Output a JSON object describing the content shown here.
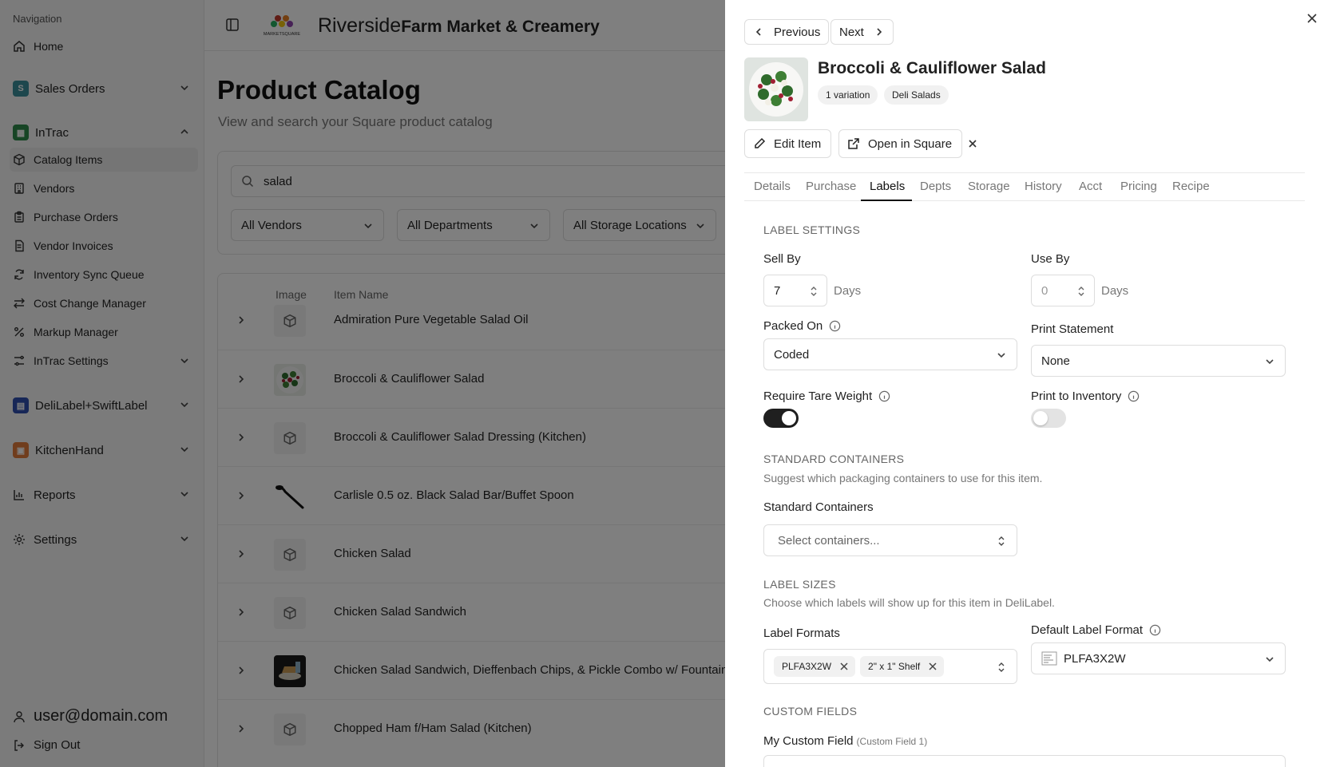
{
  "sidebar": {
    "heading": "Navigation",
    "home": "Home",
    "sales_orders": "Sales Orders",
    "intrac": "InTrac",
    "items": [
      "Catalog Items",
      "Vendors",
      "Purchase Orders",
      "Vendor Invoices",
      "Inventory Sync Queue",
      "Cost Change Manager",
      "Markup Manager",
      "InTrac Settings"
    ],
    "delilabel": "DeliLabel+SwiftLabel",
    "kitchenhand": "KitchenHand",
    "reports": "Reports",
    "settings": "Settings",
    "user": "user@domain.com",
    "sign_out": "Sign Out"
  },
  "header": {
    "brand_light": "Riverside",
    "brand_bold": "Farm Market & Creamery",
    "logo_text": "MARKETSQUARE"
  },
  "page": {
    "title": "Product Catalog",
    "subtitle": "View and search your Square product catalog"
  },
  "filters": {
    "search_value": "salad",
    "vendors": "All Vendors",
    "departments": "All Departments",
    "storage": "All Storage Locations"
  },
  "table": {
    "col_image": "Image",
    "col_name": "Item Name",
    "rows": [
      "Admiration Pure Vegetable Salad Oil",
      "Broccoli & Cauliflower Salad",
      "Broccoli & Cauliflower Salad Dressing (Kitchen)",
      "Carlisle 0.5 oz. Black Salad Bar/Buffet Spoon",
      "Chicken Salad",
      "Chicken Salad Sandwich",
      "Chicken Salad Sandwich, Dieffenbach Chips, & Pickle Combo w/ Fountain Drink",
      "Chopped Ham f/Ham Salad (Kitchen)"
    ]
  },
  "drawer": {
    "prev": "Previous",
    "next": "Next",
    "item_title": "Broccoli & Cauliflower Salad",
    "variation_badge": "1 variation",
    "category_badge": "Deli Salads",
    "edit_item": "Edit Item",
    "open_square": "Open in Square",
    "tabs": [
      "Details",
      "Purchase",
      "Labels",
      "Depts",
      "Storage",
      "History",
      "Acct",
      "Pricing",
      "Recipe"
    ],
    "active_tab": "Labels",
    "label_settings": "LABEL SETTINGS",
    "sell_by": "Sell By",
    "sell_by_value": "7",
    "use_by": "Use By",
    "use_by_placeholder": "0",
    "days": "Days",
    "packed_on": "Packed On",
    "packed_on_value": "Coded",
    "print_statement": "Print Statement",
    "print_statement_value": "None",
    "require_tare": "Require Tare Weight",
    "require_tare_on": true,
    "print_inventory": "Print to Inventory",
    "print_inventory_on": false,
    "std_containers_head": "STANDARD CONTAINERS",
    "std_containers_desc": "Suggest which packaging containers to use for this item.",
    "std_containers_label": "Standard Containers",
    "std_containers_placeholder": "Select containers...",
    "label_sizes_head": "LABEL SIZES",
    "label_sizes_desc": "Choose which labels will show up for this item in DeliLabel.",
    "label_formats": "Label Formats",
    "format_chips": [
      "PLFA3X2W",
      "2\" x 1\" Shelf"
    ],
    "default_label_format": "Default Label Format",
    "default_label_value": "PLFA3X2W",
    "custom_fields_head": "CUSTOM FIELDS",
    "my_custom_field": "My Custom Field",
    "custom_field_hint": "(Custom Field 1)"
  },
  "colors": {
    "sales_orders_icon": "#3a8f9a",
    "intrac_icon": "#2f8a4a",
    "delilabel_icon": "#2f4fae",
    "kitchenhand_icon": "#e07a3b",
    "toggle_on": "#1f1f1f",
    "toggle_off": "#e3e3e3"
  }
}
